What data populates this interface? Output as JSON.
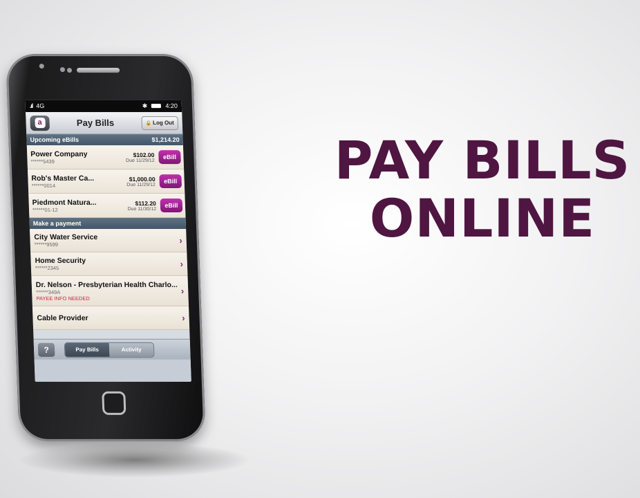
{
  "headline": {
    "line1": "PAY BILLS",
    "line2": "ONLINE"
  },
  "statusbar": {
    "signal": ".ıl",
    "network": "4G",
    "bluetooth": "✱",
    "time": "4:20"
  },
  "navbar": {
    "logo": "a",
    "title": "Pay Bills",
    "logout": "Log Out",
    "lock_icon": "🔒"
  },
  "upcoming": {
    "header": "Upcoming eBills",
    "total": "$1,214.20",
    "button_label": "eBill",
    "items": [
      {
        "name": "Power Company",
        "account": "******5439",
        "amount": "$102.00",
        "due": "Due 11/29/12"
      },
      {
        "name": "Rob's Master Ca...",
        "account": "******0014",
        "amount": "$1,000.00",
        "due": "Due 11/29/12"
      },
      {
        "name": "Piedmont Natura...",
        "account": "******01-12",
        "amount": "$112.20",
        "due": "Due 11/30/12"
      }
    ]
  },
  "payment": {
    "header": "Make a payment",
    "chevron": "›",
    "items": [
      {
        "name": "City Water Service",
        "account": "******9599",
        "note": ""
      },
      {
        "name": "Home Security",
        "account": "******2345",
        "note": ""
      },
      {
        "name": "Dr. Nelson - Presbyterian Health Charlo...",
        "account": "******349A",
        "note": "PAYEE INFO NEEDED"
      },
      {
        "name": "Cable Provider",
        "account": "",
        "note": ""
      }
    ]
  },
  "toolbar": {
    "help": "?",
    "tabs": [
      "Pay Bills",
      "Activity"
    ],
    "active_tab": "Pay Bills"
  }
}
